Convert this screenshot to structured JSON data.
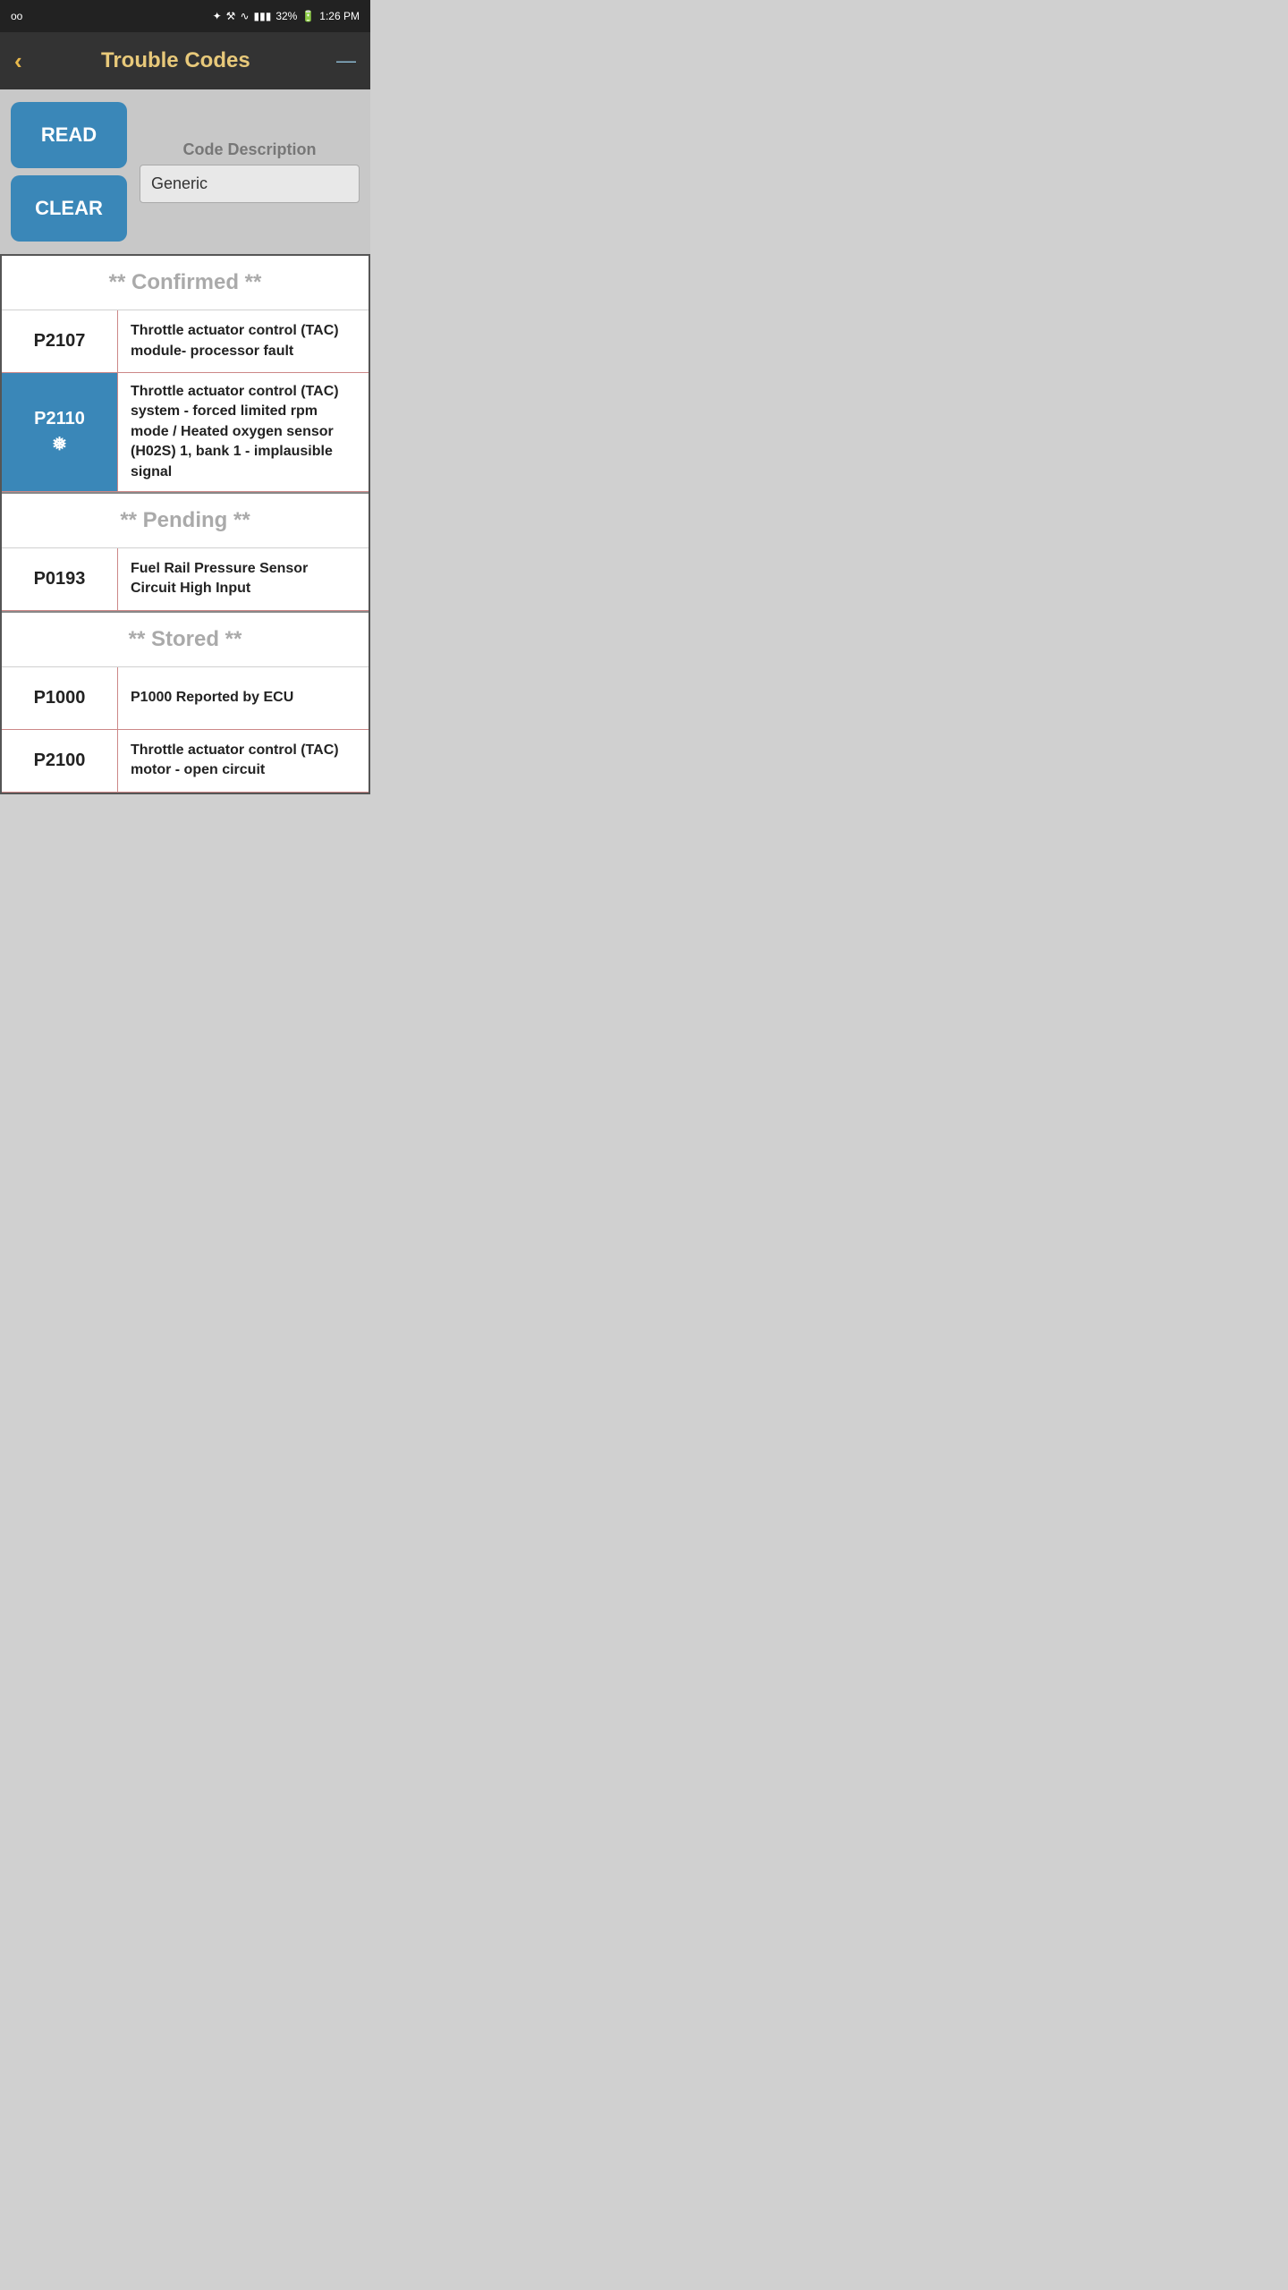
{
  "statusBar": {
    "leftIcon": "oo",
    "bluetooth": "⚑",
    "alarm": "⏰",
    "wifi": "WiFi",
    "signal": "32%",
    "battery": "🔋",
    "time": "1:26 PM"
  },
  "header": {
    "backLabel": "‹",
    "title": "Trouble Codes",
    "menuLabel": "—"
  },
  "controls": {
    "readLabel": "READ",
    "clearLabel": "CLEAR",
    "codeDescLabel": "Code Description",
    "codeDescValue": "Generic"
  },
  "sections": {
    "confirmed": {
      "title": "** Confirmed **",
      "codes": [
        {
          "code": "P2107",
          "description": "Throttle actuator control (TAC) module- processor fault",
          "selected": false,
          "freeze": false
        },
        {
          "code": "P2110",
          "description": "Throttle actuator control (TAC) system - forced limited rpm mode / Heated oxygen sensor (H02S) 1, bank 1 - implausible signal",
          "selected": true,
          "freeze": true
        }
      ]
    },
    "pending": {
      "title": "** Pending **",
      "codes": [
        {
          "code": "P0193",
          "description": "Fuel Rail Pressure Sensor Circuit High Input",
          "selected": false,
          "freeze": false
        }
      ]
    },
    "stored": {
      "title": "** Stored **",
      "codes": [
        {
          "code": "P1000",
          "description": "P1000 Reported by ECU",
          "selected": false,
          "freeze": false
        },
        {
          "code": "P2100",
          "description": "Throttle actuator control (TAC) motor - open circuit",
          "selected": false,
          "freeze": false
        }
      ]
    }
  }
}
